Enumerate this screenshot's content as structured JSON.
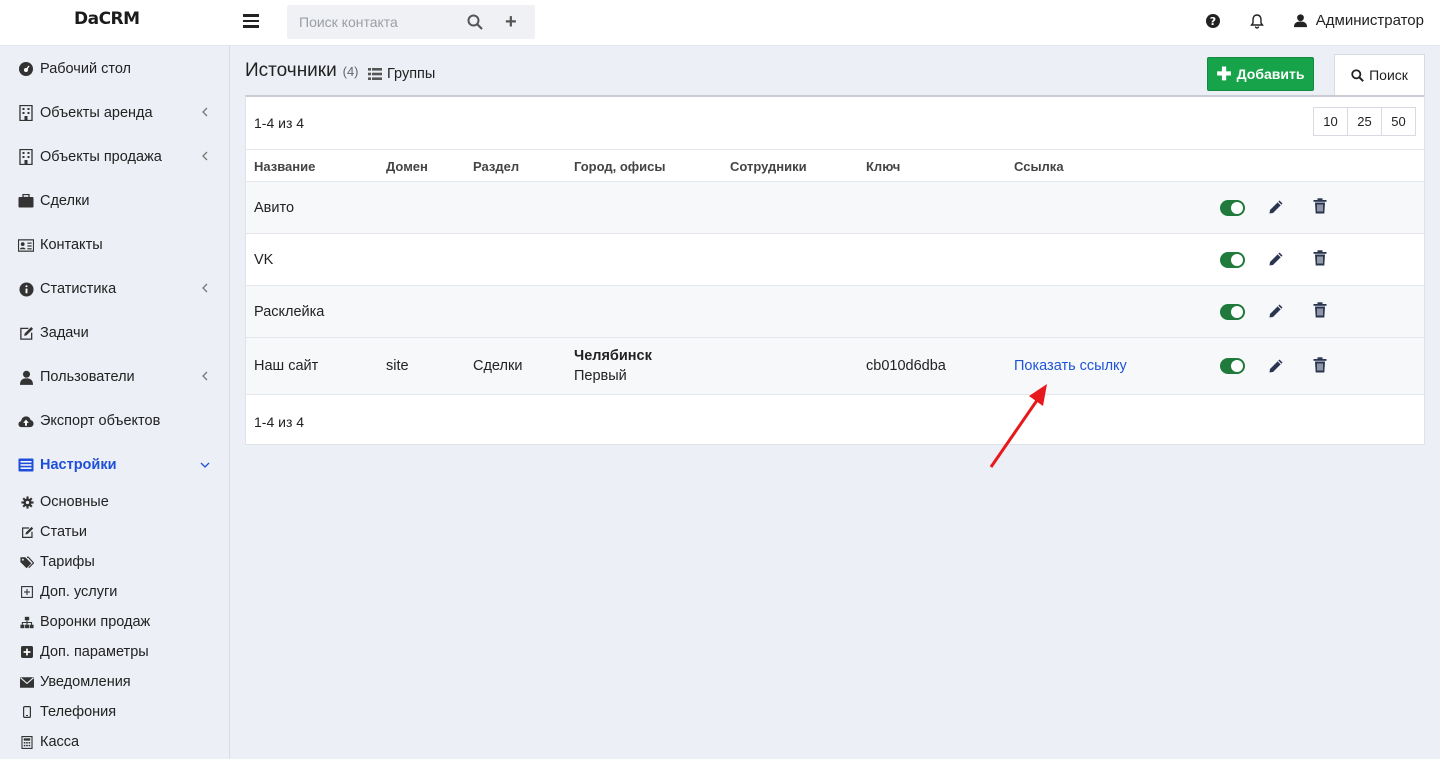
{
  "app": {
    "logo": "DaCRM"
  },
  "topbar": {
    "search_placeholder": "Поиск контакта",
    "user_name": "Администратор"
  },
  "sidebar": {
    "items": [
      {
        "label": "Рабочий стол",
        "icon": "dashboard-icon"
      },
      {
        "label": "Объекты аренда",
        "icon": "building-icon"
      },
      {
        "label": "Объекты продажа",
        "icon": "building-icon"
      },
      {
        "label": "Сделки",
        "icon": "briefcase-icon"
      },
      {
        "label": "Контакты",
        "icon": "contact-card-icon"
      },
      {
        "label": "Статистика",
        "icon": "info-icon"
      },
      {
        "label": "Задачи",
        "icon": "edit-icon"
      },
      {
        "label": "Пользователи",
        "icon": "user-icon"
      },
      {
        "label": "Экспорт объектов",
        "icon": "cloud-upload-icon"
      },
      {
        "label": "Настройки",
        "icon": "list-icon"
      }
    ],
    "subitems": [
      {
        "label": "Основные",
        "icon": "gear-icon"
      },
      {
        "label": "Статьи",
        "icon": "edit-icon"
      },
      {
        "label": "Тарифы",
        "icon": "tags-icon"
      },
      {
        "label": "Доп. услуги",
        "icon": "plus-square-icon"
      },
      {
        "label": "Воронки продаж",
        "icon": "sitemap-icon"
      },
      {
        "label": "Доп. параметры",
        "icon": "plus-box-icon"
      },
      {
        "label": "Уведомления",
        "icon": "envelope-icon"
      },
      {
        "label": "Телефония",
        "icon": "phone-icon"
      },
      {
        "label": "Касса",
        "icon": "calculator-icon"
      }
    ]
  },
  "page": {
    "title": "Источники",
    "count": "(4)",
    "groups_label": "Группы",
    "add_label": "Добавить",
    "search_label": "Поиск",
    "pager_top": "1-4 из 4",
    "pager_bottom": "1-4 из 4",
    "page_sizes": [
      "10",
      "25",
      "50"
    ]
  },
  "table": {
    "columns": [
      "Название",
      "Домен",
      "Раздел",
      "Город, офисы",
      "Сотрудники",
      "Ключ",
      "Ссылка"
    ],
    "rows": [
      {
        "name": "Авито",
        "domain": "",
        "section": "",
        "city": "",
        "office": "",
        "staff": "",
        "key": "",
        "link": "",
        "enabled": true
      },
      {
        "name": "VK",
        "domain": "",
        "section": "",
        "city": "",
        "office": "",
        "staff": "",
        "key": "",
        "link": "",
        "enabled": true
      },
      {
        "name": "Расклейка",
        "domain": "",
        "section": "",
        "city": "",
        "office": "",
        "staff": "",
        "key": "",
        "link": "",
        "enabled": true
      },
      {
        "name": "Наш сайт",
        "domain": "site",
        "section": "Сделки",
        "city": "Челябинск",
        "office": "Первый",
        "staff": "",
        "key": "cb010d6dba",
        "link": "Показать ссылку",
        "enabled": true
      }
    ]
  },
  "colors": {
    "accent": "#1e4fd8",
    "add_button": "#17a34a",
    "toggle_on": "#207a3b",
    "annotation_arrow": "#e8191c"
  }
}
